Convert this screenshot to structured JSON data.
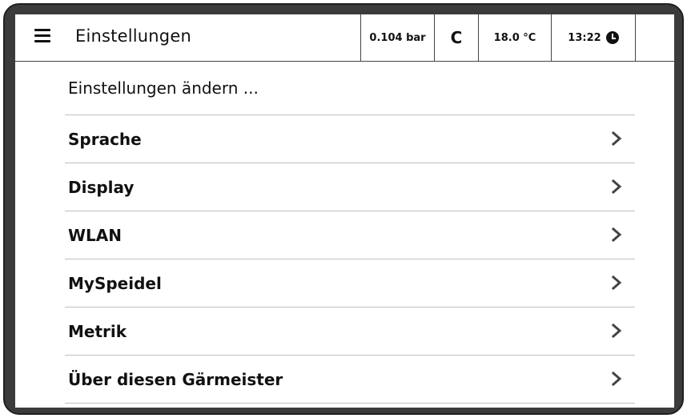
{
  "header": {
    "title": "Einstellungen",
    "menu_icon": "hamburger-menu-icon",
    "status": {
      "pressure": "0.104 bar",
      "mode": "C",
      "temperature": "18.0 °C",
      "time": "13:22",
      "time_icon": "clock-icon"
    }
  },
  "main": {
    "subheading": "Einstellungen ändern ...",
    "items": [
      {
        "label": "Sprache",
        "icon": "chevron-right-icon"
      },
      {
        "label": "Display",
        "icon": "chevron-right-icon"
      },
      {
        "label": "WLAN",
        "icon": "chevron-right-icon"
      },
      {
        "label": "MySpeidel",
        "icon": "chevron-right-icon"
      },
      {
        "label": "Metrik",
        "icon": "chevron-right-icon"
      },
      {
        "label": "Über diesen Gärmeister",
        "icon": "chevron-right-icon"
      }
    ]
  },
  "colors": {
    "frame": "#3b3b3b",
    "screen": "#ffffff",
    "text": "#111111",
    "divider": "#bfbfbf"
  }
}
